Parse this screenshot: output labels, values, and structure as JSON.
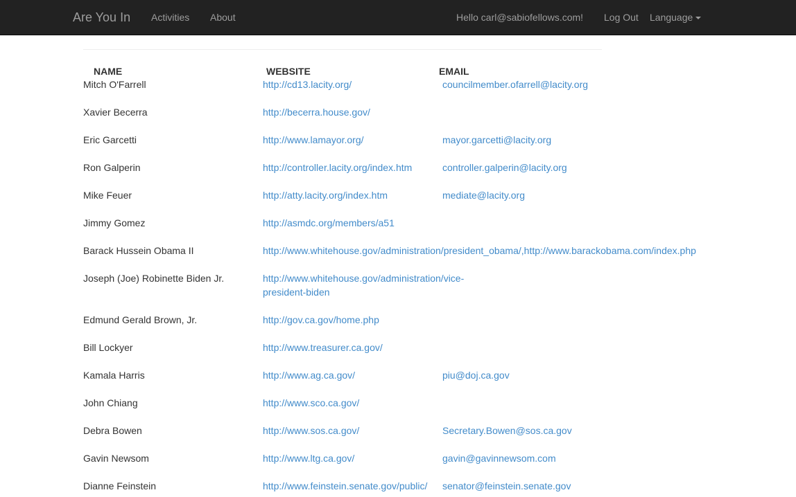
{
  "navbar": {
    "brand": "Are You In",
    "links": [
      "Activities",
      "About"
    ],
    "greeting": "Hello carl@sabiofellows.com!",
    "logout": "Log Out",
    "language": "Language"
  },
  "table": {
    "headers": {
      "name": "NAME",
      "website": "WEBSITE",
      "email": "EMAIL"
    },
    "rows": [
      {
        "name": "Mitch O'Farrell",
        "website": "http://cd13.lacity.org/",
        "email": "councilmember.ofarrell@lacity.org"
      },
      {
        "name": "Xavier Becerra",
        "website": "http://becerra.house.gov/",
        "email": ""
      },
      {
        "name": "Eric Garcetti",
        "website": "http://www.lamayor.org/",
        "email": "mayor.garcetti@lacity.org"
      },
      {
        "name": "Ron Galperin",
        "website": "http://controller.lacity.org/index.htm",
        "email": "controller.galperin@lacity.org"
      },
      {
        "name": "Mike Feuer",
        "website": "http://atty.lacity.org/index.htm",
        "email": "mediate@lacity.org"
      },
      {
        "name": "Jimmy Gomez",
        "website": "http://asmdc.org/members/a51",
        "email": ""
      },
      {
        "name": "Barack Hussein Obama II",
        "website": "http://www.whitehouse.gov/administration/president_obama/,http://www.barackobama.com/index.php",
        "email": ""
      },
      {
        "name": "Joseph (Joe) Robinette Biden Jr.",
        "website": "http://www.whitehouse.gov/administration/vice-president-biden",
        "email": ""
      },
      {
        "name": "Edmund Gerald Brown, Jr.",
        "website": "http://gov.ca.gov/home.php",
        "email": ""
      },
      {
        "name": "Bill Lockyer",
        "website": "http://www.treasurer.ca.gov/",
        "email": ""
      },
      {
        "name": "Kamala Harris",
        "website": "http://www.ag.ca.gov/",
        "email": "piu@doj.ca.gov"
      },
      {
        "name": "John Chiang",
        "website": "http://www.sco.ca.gov/",
        "email": ""
      },
      {
        "name": "Debra Bowen",
        "website": "http://www.sos.ca.gov/",
        "email": "Secretary.Bowen@sos.ca.gov"
      },
      {
        "name": "Gavin Newsom",
        "website": "http://www.ltg.ca.gov/",
        "email": "gavin@gavinnewsom.com"
      },
      {
        "name": "Dianne Feinstein",
        "website": "http://www.feinstein.senate.gov/public/",
        "email": "senator@feinstein.senate.gov"
      }
    ]
  },
  "colors": {
    "navbar_bg": "#222222",
    "nav_text": "#9d9d9d",
    "link": "#428bca",
    "text": "#333333"
  }
}
